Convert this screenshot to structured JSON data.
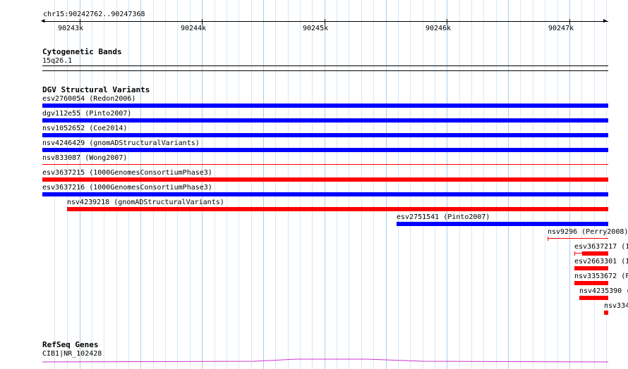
{
  "ruler": {
    "location": "chr15:90242762..90247368",
    "ticks": [
      "90243k",
      "90244k",
      "90245k",
      "90246k",
      "90247k"
    ]
  },
  "cytoband": {
    "title": "Cytogenetic Bands",
    "label": "15q26.1"
  },
  "dgv": {
    "title": "DGV Structural Variants",
    "features": [
      {
        "label": "esv2760054 (Redon2006)",
        "color": "#0000ff"
      },
      {
        "label": "dgv112e55 (Pinto2007)",
        "color": "#0000ff"
      },
      {
        "label": "nsv1052652 (Coe2014)",
        "color": "#0000ff"
      },
      {
        "label": "nsv4246429 (gnomADStructuralVariants)",
        "color": "#0000ff"
      },
      {
        "label": "nsv833087 (Wong2007)",
        "color": "#ff0000"
      },
      {
        "label": "esv3637215 (1000GenomesConsortiumPhase3)",
        "color": "#ff0000"
      },
      {
        "label": "esv3637216 (1000GenomesConsortiumPhase3)",
        "color": "#0000ff"
      },
      {
        "label": "nsv4239218 (gnomADStructuralVariants)",
        "color": "#ff0000"
      },
      {
        "label": "esv2751541 (Pinto2007)",
        "color": "#0000ff"
      },
      {
        "label": "nsv9296 (Perry2008)",
        "color": "#ff0000"
      },
      {
        "label": "esv3637217 (1",
        "color": "#ff0000"
      },
      {
        "label": "esv2663301 (1",
        "color": "#ff0000"
      },
      {
        "label": "nsv3353672 (F",
        "color": "#ff0000"
      },
      {
        "label": "nsv4235390 (",
        "color": "#ff0000"
      },
      {
        "label": "nsv334",
        "color": "#ff0000"
      }
    ]
  },
  "refseq": {
    "title": "RefSeq Genes",
    "label": "CIB1|NR_102428",
    "color": "#cc33cc"
  }
}
